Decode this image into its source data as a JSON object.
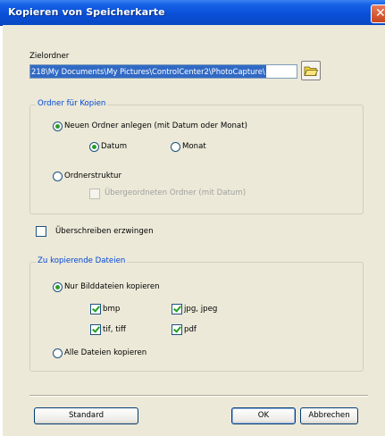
{
  "window": {
    "title": "Kopieren von Speicherkarte"
  },
  "target_folder": {
    "label": "Zielordner",
    "value": "218\\My Documents\\My Pictures\\ControlCenter2\\PhotoCapture\\"
  },
  "folder_group": {
    "legend": "Ordner für Kopien",
    "new_folder": {
      "label": "Neuen Ordner anlegen (mit Datum oder Monat)",
      "selected": true
    },
    "date": {
      "label": "Datum",
      "selected": true
    },
    "month": {
      "label": "Monat",
      "selected": false
    },
    "structure": {
      "label": "Ordnerstruktur",
      "selected": false
    },
    "parent_folder": {
      "label": "Übergeordneten Ordner (mit Datum)",
      "checked": false,
      "enabled": false
    }
  },
  "overwrite": {
    "label": "Überschreiben erzwingen",
    "checked": false
  },
  "files_group": {
    "legend": "Zu kopierende Dateien",
    "only_images": {
      "label": "Nur Bilddateien kopieren",
      "selected": true
    },
    "bmp": {
      "label": "bmp",
      "checked": true
    },
    "jpg": {
      "label": "jpg, jpeg",
      "checked": true
    },
    "tif": {
      "label": "tif, tiff",
      "checked": true
    },
    "pdf": {
      "label": "pdf",
      "checked": true
    },
    "all_files": {
      "label": "Alle Dateien kopieren",
      "selected": false
    }
  },
  "buttons": {
    "standard": "Standard",
    "ok": "OK",
    "cancel": "Abbrechen"
  }
}
